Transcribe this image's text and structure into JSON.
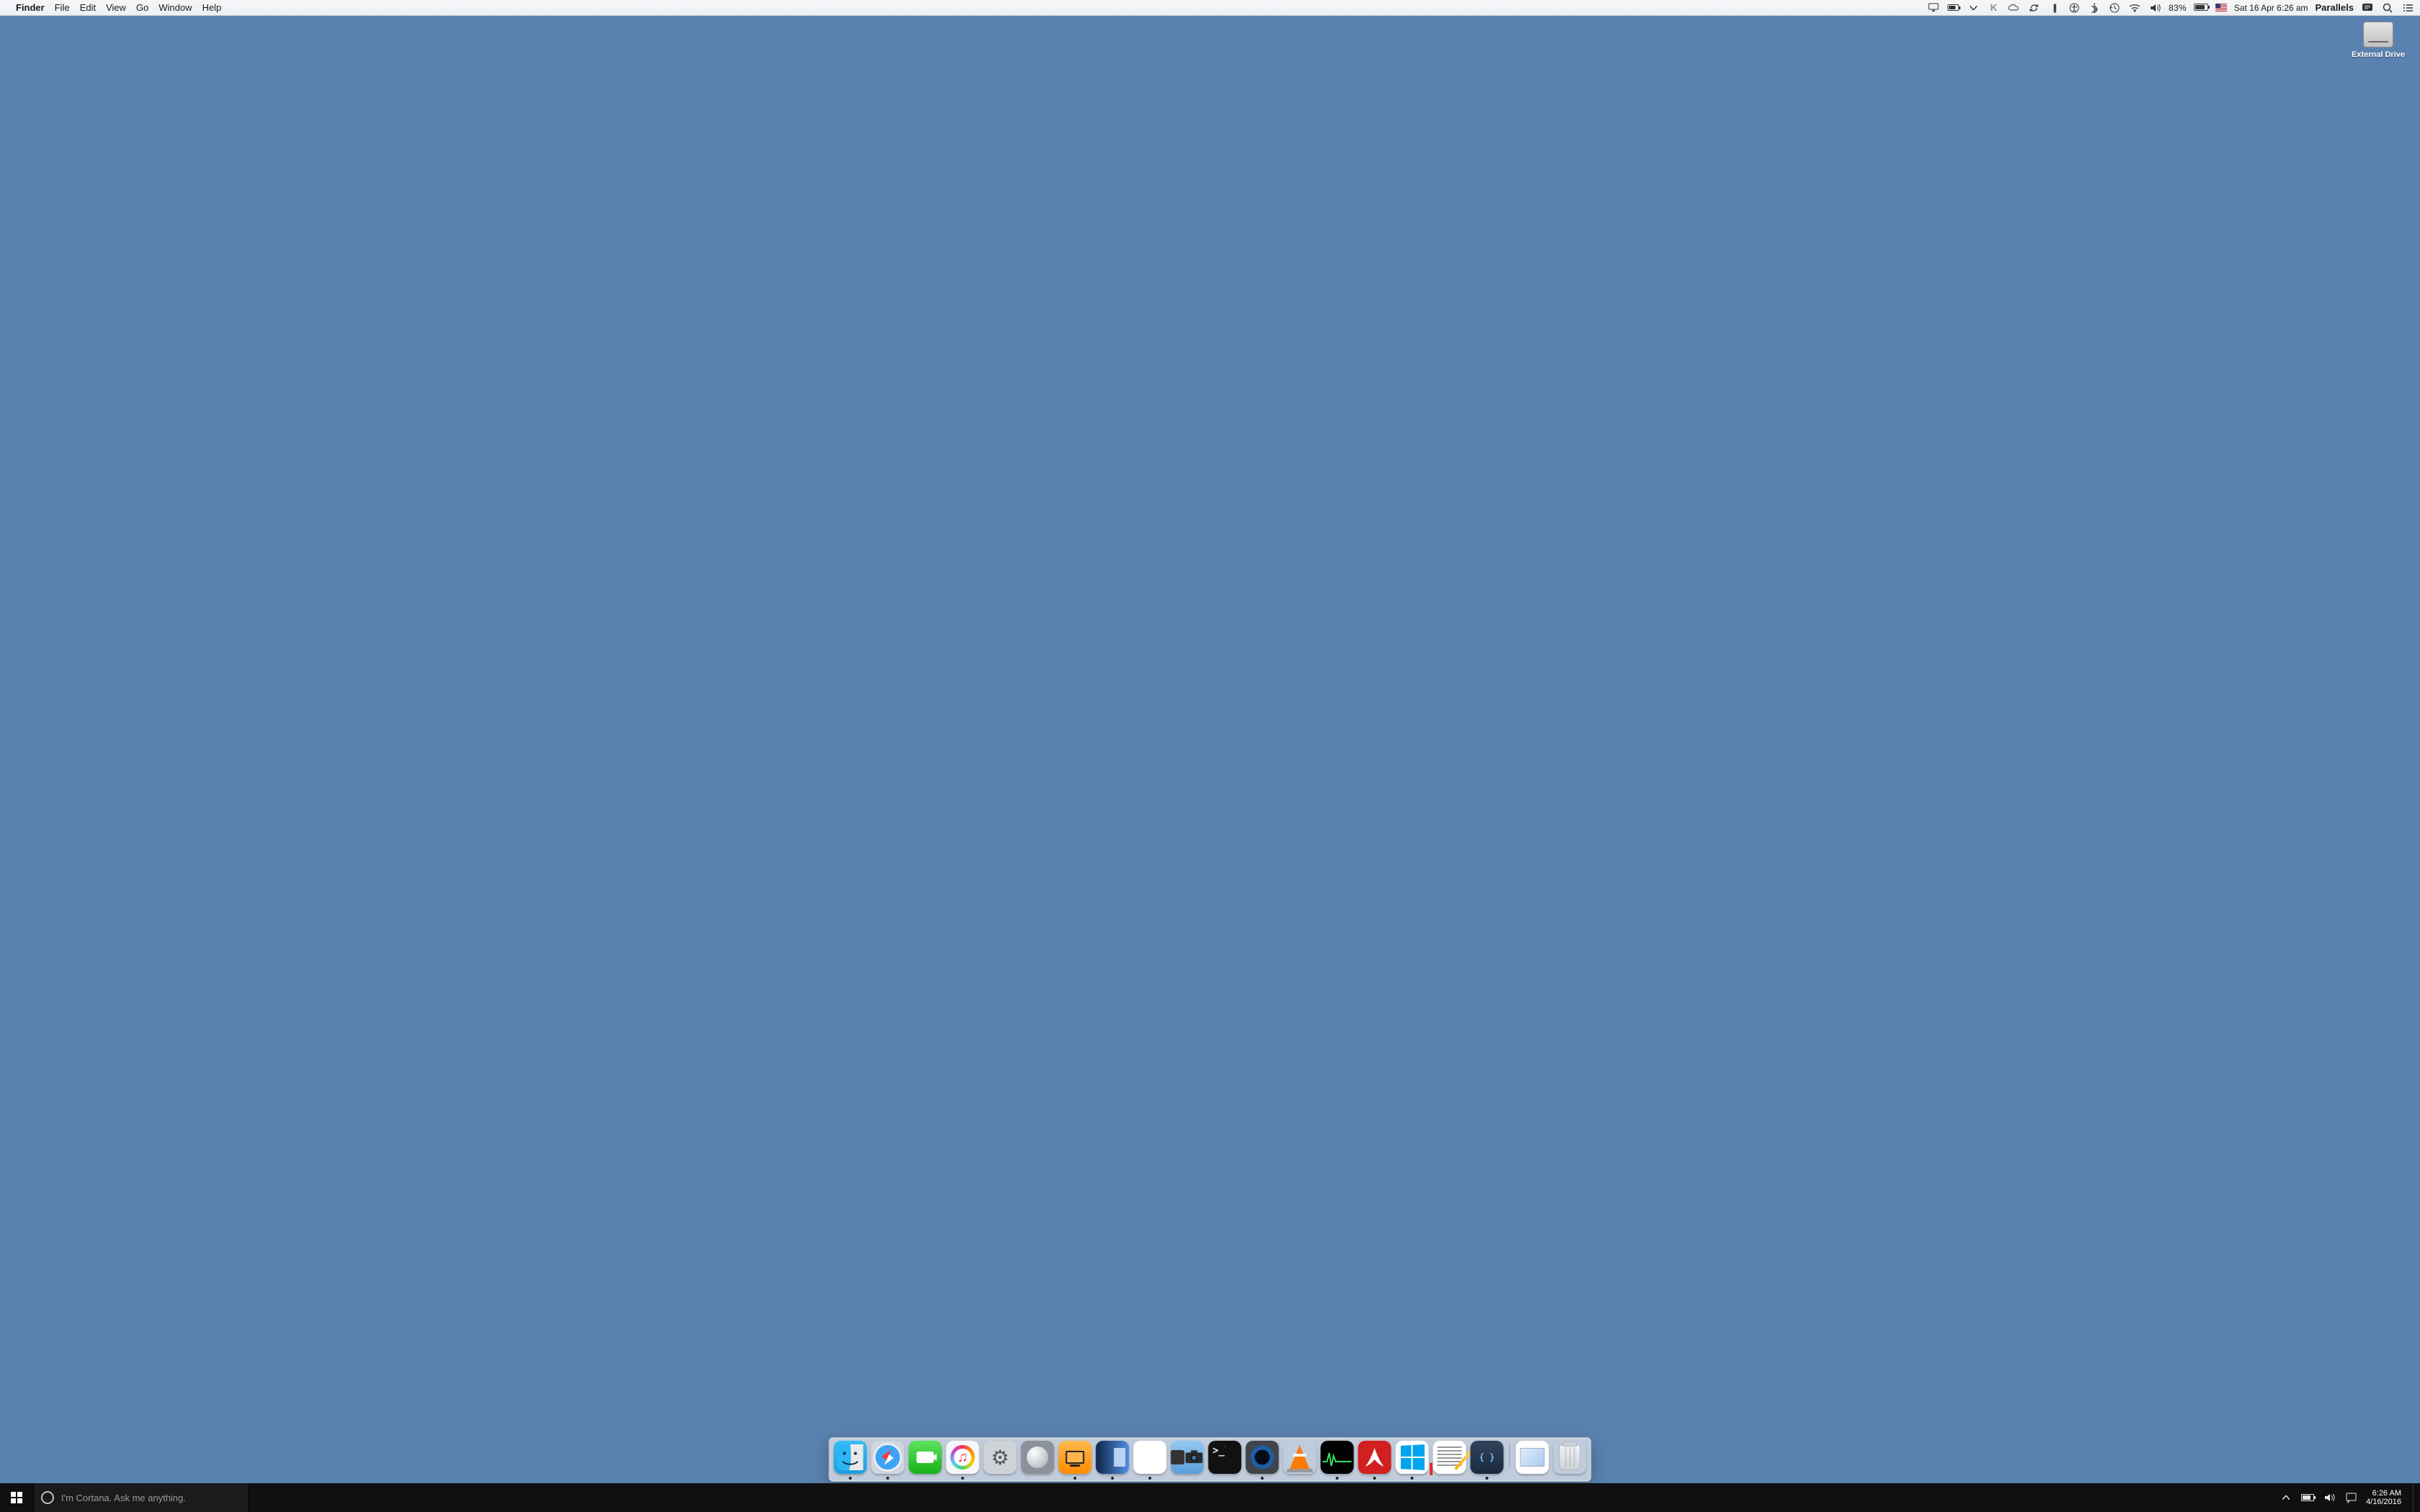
{
  "mac_menubar": {
    "app_name": "Finder",
    "menus": [
      "File",
      "Edit",
      "View",
      "Go",
      "Window",
      "Help"
    ],
    "battery_percent": "83%",
    "datetime": "Sat 16 Apr  6:26 am",
    "right_app": "Parallels",
    "status_icons": [
      "airplay-audio-icon",
      "battery-menu-icon",
      "dropdown-icon",
      "k-icon",
      "creative-cloud-icon",
      "sync-icon",
      "parallels-icon",
      "accessibility-icon",
      "bluetooth-icon",
      "time-machine-icon",
      "wifi-icon",
      "volume-icon"
    ],
    "right_extras": [
      "messages-icon",
      "spotlight-icon",
      "menu-list-icon"
    ],
    "flag": "us-flag"
  },
  "desktop": {
    "icons": [
      {
        "name": "external-drive",
        "label": "External Drive"
      }
    ]
  },
  "dock": {
    "apps": [
      {
        "name": "finder",
        "running": true
      },
      {
        "name": "safari",
        "running": true
      },
      {
        "name": "facetime",
        "running": false
      },
      {
        "name": "itunes",
        "running": true
      },
      {
        "name": "system-preferences",
        "running": false
      },
      {
        "name": "launchpad",
        "running": false
      },
      {
        "name": "accessibility",
        "running": false
      },
      {
        "name": "parallels-control",
        "running": true
      },
      {
        "name": "parallels-desktop",
        "running": true
      },
      {
        "name": "image-capture",
        "running": false
      },
      {
        "name": "terminal",
        "running": true
      },
      {
        "name": "quicktime",
        "running": true
      },
      {
        "name": "vlc",
        "running": false
      },
      {
        "name": "activity-monitor",
        "running": true
      },
      {
        "name": "acrobat",
        "running": true
      },
      {
        "name": "windows-10-vm",
        "running": true
      },
      {
        "name": "textedit",
        "running": false
      },
      {
        "name": "code-editor",
        "running": true
      }
    ],
    "right": [
      {
        "name": "preview-document",
        "running": false
      },
      {
        "name": "trash",
        "running": false
      }
    ]
  },
  "win_taskbar": {
    "cortana_placeholder": "I'm Cortana. Ask me anything.",
    "tray_icons": [
      "chevron-up-icon",
      "battery-icon",
      "volume-icon",
      "action-center-icon"
    ],
    "time": "6:26 AM",
    "date": "4/16/2016"
  }
}
